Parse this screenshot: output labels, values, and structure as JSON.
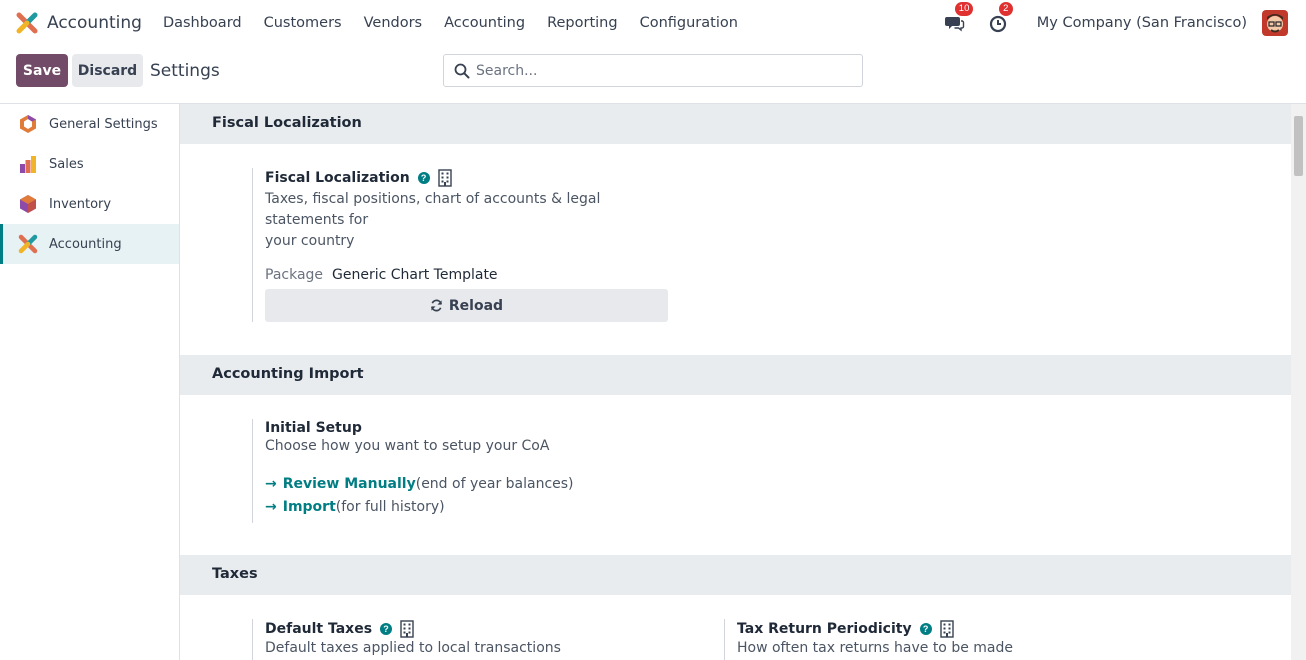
{
  "navbar": {
    "app_name": "Accounting",
    "menu": [
      "Dashboard",
      "Customers",
      "Vendors",
      "Accounting",
      "Reporting",
      "Configuration"
    ],
    "messages_count": "10",
    "activities_count": "2",
    "company": "My Company (San Francisco)"
  },
  "control": {
    "save_label": "Save",
    "discard_label": "Discard",
    "breadcrumb": "Settings",
    "search_placeholder": "Search..."
  },
  "sidebar": {
    "items": [
      {
        "label": "General Settings",
        "icon": "general-settings-icon"
      },
      {
        "label": "Sales",
        "icon": "sales-icon"
      },
      {
        "label": "Inventory",
        "icon": "inventory-icon"
      },
      {
        "label": "Accounting",
        "icon": "accounting-icon",
        "active": true
      }
    ]
  },
  "sections": {
    "fiscal": {
      "header": "Fiscal Localization",
      "title": "Fiscal Localization",
      "desc_line1": "Taxes, fiscal positions, chart of accounts & legal statements for",
      "desc_line2": "your country",
      "package_label": "Package",
      "package_value": "Generic Chart Template",
      "reload_label": "Reload"
    },
    "import": {
      "header": "Accounting Import",
      "title": "Initial Setup",
      "desc": "Choose how you want to setup your CoA",
      "link1": "Review Manually",
      "link1_note": "(end of year balances)",
      "link2": "Import",
      "link2_note": "(for full history)"
    },
    "taxes": {
      "header": "Taxes",
      "default_title": "Default Taxes",
      "default_desc": "Default taxes applied to local transactions",
      "periodicity_title": "Tax Return Periodicity",
      "periodicity_desc": "How often tax returns have to be made"
    }
  },
  "colors": {
    "brand": "#714b67",
    "accent": "#017e84",
    "badge": "#e03131"
  }
}
